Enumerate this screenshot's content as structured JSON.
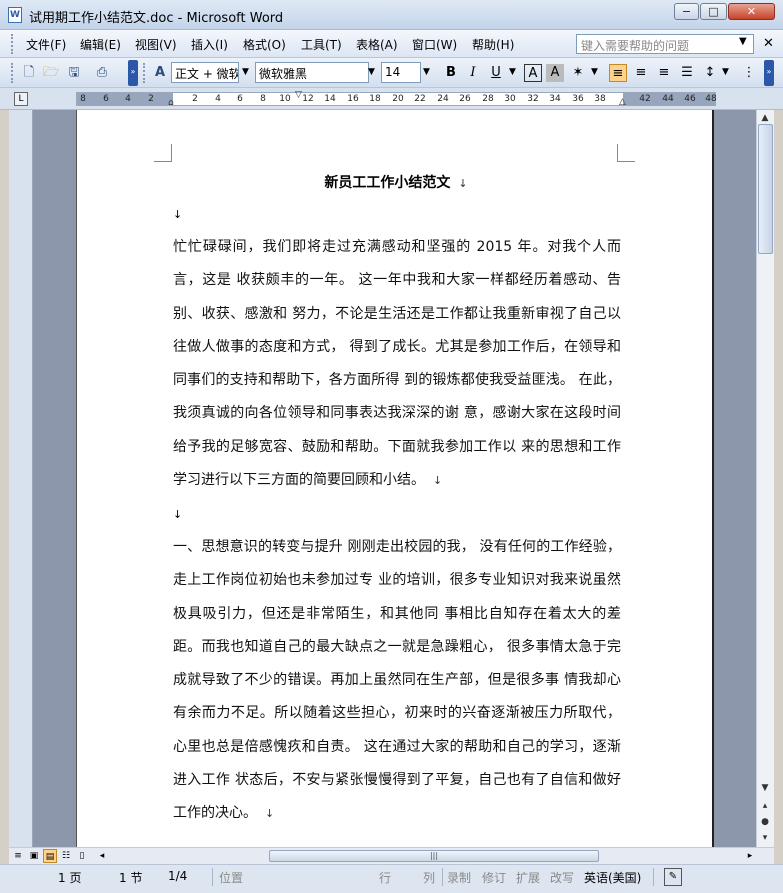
{
  "window": {
    "title": "试用期工作小结范文.doc - Microsoft Word",
    "app_icon_label": "W",
    "controls": {
      "minimize": "−",
      "maximize": "□",
      "close": "✕"
    }
  },
  "menu": {
    "items": [
      "文件(F)",
      "编辑(E)",
      "视图(V)",
      "插入(I)",
      "格式(O)",
      "工具(T)",
      "表格(A)",
      "窗口(W)",
      "帮助(H)"
    ],
    "help_placeholder": "键入需要帮助的问题"
  },
  "toolbar": {
    "style_value": "正文 + 微软",
    "font_value": "微软雅黑",
    "size_value": "14",
    "bold": "B",
    "italic": "I",
    "underline": "U",
    "char_border": "A",
    "char_shading": "A",
    "icons": [
      "new-document-icon",
      "open-folder-icon",
      "save-icon",
      "print-icon",
      "styles-icon",
      "text-effects-icon",
      "align-left-icon",
      "align-center-icon",
      "align-right-icon",
      "justify-icon",
      "line-spacing-icon",
      "numbering-icon"
    ]
  },
  "ruler": {
    "ticks": [
      "8",
      "6",
      "4",
      "2",
      "2",
      "4",
      "6",
      "8",
      "10",
      "12",
      "14",
      "16",
      "18",
      "20",
      "22",
      "24",
      "26",
      "28",
      "30",
      "32",
      "34",
      "36",
      "38",
      "42",
      "44",
      "46",
      "48"
    ]
  },
  "document": {
    "title": "新员工工作小结范文",
    "paragraph_mark": "↓",
    "paragraphs": [
      "忙忙碌碌间，我们即将走过充满感动和坚强的 2015 年。对我个人而言，这是 收获颇丰的一年。 这一年中我和大家一样都经历着感动、告别、收获、感激和 努力，不论是生活还是工作都让我重新审视了自己以往做人做事的态度和方式， 得到了成长。尤其是参加工作后，在领导和同事们的支持和帮助下，各方面所得 到的锻炼都使我受益匪浅。 在此，我须真诚的向各位领导和同事表达我深深的谢 意，感谢大家在这段时间给予我的足够宽容、鼓励和帮助。下面就我参加工作以 来的思想和工作学习进行以下三方面的简要回顾和小结。",
      "一、思想意识的转变与提升 刚刚走出校园的我， 没有任何的工作经验，走上工作岗位初始也未参加过专 业的培训，很多专业知识对我来说虽然极具吸引力，但还是非常陌生，和其他同 事相比自知存在着太大的差距。而我也知道自己的最大缺点之一就是急躁粗心， 很多事情太急于完成就导致了不少的错误。再加上虽然同在生产部，但是很多事 情我却心有余而力不足。所以随着这些担心，初来时的兴奋逐渐被压力所取代， 心里也总是倍感愧疚和自责。 这在通过大家的帮助和自己的学习，逐渐进入工作 状态后，不安与紧张慢慢得到了平复，自己也有了自信和做好工作的决心。"
    ]
  },
  "statusbar": {
    "page": "1 页",
    "section": "1 节",
    "page_of": "1/4",
    "position": "位置",
    "line": "行",
    "column": "列",
    "record": "录制",
    "revision": "修订",
    "extend": "扩展",
    "overtype": "改写",
    "language": "英语(美国)"
  }
}
